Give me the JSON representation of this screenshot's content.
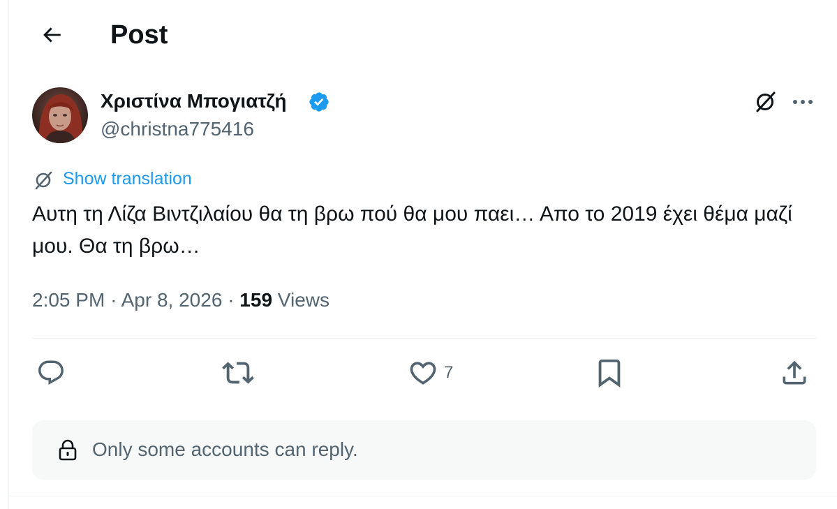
{
  "header": {
    "title": "Post"
  },
  "author": {
    "display_name": "Χριστίνα Μπογιατζή",
    "handle": "@christna775416",
    "verified": true
  },
  "post": {
    "show_translation_label": "Show translation",
    "text": "Αυτη τη Λίζα Βιντζιλαίου θα τη βρω πού θα μου παει… Απο το 2019 έχει θέμα μαζί μου. Θα τη βρω…",
    "time": "2:05 PM",
    "date": "Apr 8, 2026",
    "separator": "·",
    "views_count": "159",
    "views_label": "Views"
  },
  "actions": {
    "like_count": "7"
  },
  "reply_restriction": {
    "text": "Only some accounts can reply."
  },
  "icons": {
    "back": "arrow-left-icon",
    "verified": "verified-badge-icon",
    "grok": "grok-icon",
    "more": "more-dots-icon",
    "translate": "grok-translate-icon",
    "reply": "comment-icon",
    "repost": "repost-icon",
    "like": "heart-icon",
    "bookmark": "bookmark-icon",
    "share": "share-icon",
    "lock": "lock-icon"
  },
  "colors": {
    "text": "#0f1419",
    "secondary": "#536471",
    "accent": "#1d9bf0",
    "divider": "#eff3f4",
    "reply_box_bg": "#f7f9f9"
  }
}
